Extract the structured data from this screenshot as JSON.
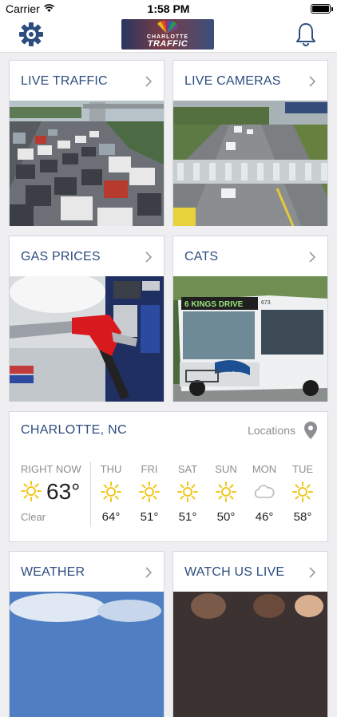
{
  "status_bar": {
    "carrier": "Carrier",
    "time": "1:58 PM"
  },
  "nav": {
    "logo_line1": "CHARLOTTE",
    "logo_line2": "TRAFFIC",
    "settings_icon": "gear-icon",
    "notifications_icon": "bell-icon"
  },
  "tiles": [
    {
      "title": "LIVE TRAFFIC"
    },
    {
      "title": "LIVE CAMERAS"
    },
    {
      "title": "GAS PRICES"
    },
    {
      "title": "CATS",
      "bus_sign": "6 KINGS DRIVE",
      "bus_number": "673",
      "bus_logo": "CATS"
    },
    {
      "title": "WEATHER"
    },
    {
      "title": "WATCH US LIVE"
    }
  ],
  "weather": {
    "city": "CHARLOTTE, NC",
    "locations_label": "Locations",
    "now_label": "RIGHT NOW",
    "now_temp": "63°",
    "now_condition": "Clear",
    "forecast": [
      {
        "day": "THU",
        "temp": "64°",
        "icon": "sun-icon"
      },
      {
        "day": "FRI",
        "temp": "51°",
        "icon": "sun-icon"
      },
      {
        "day": "SAT",
        "temp": "51°",
        "icon": "sun-icon"
      },
      {
        "day": "SUN",
        "temp": "50°",
        "icon": "sun-icon"
      },
      {
        "day": "MON",
        "temp": "46°",
        "icon": "cloud-icon"
      },
      {
        "day": "TUE",
        "temp": "58°",
        "icon": "sun-icon"
      }
    ]
  },
  "colors": {
    "accent": "#2d4d80",
    "sun": "#f2c61c",
    "background": "#efeff2"
  }
}
